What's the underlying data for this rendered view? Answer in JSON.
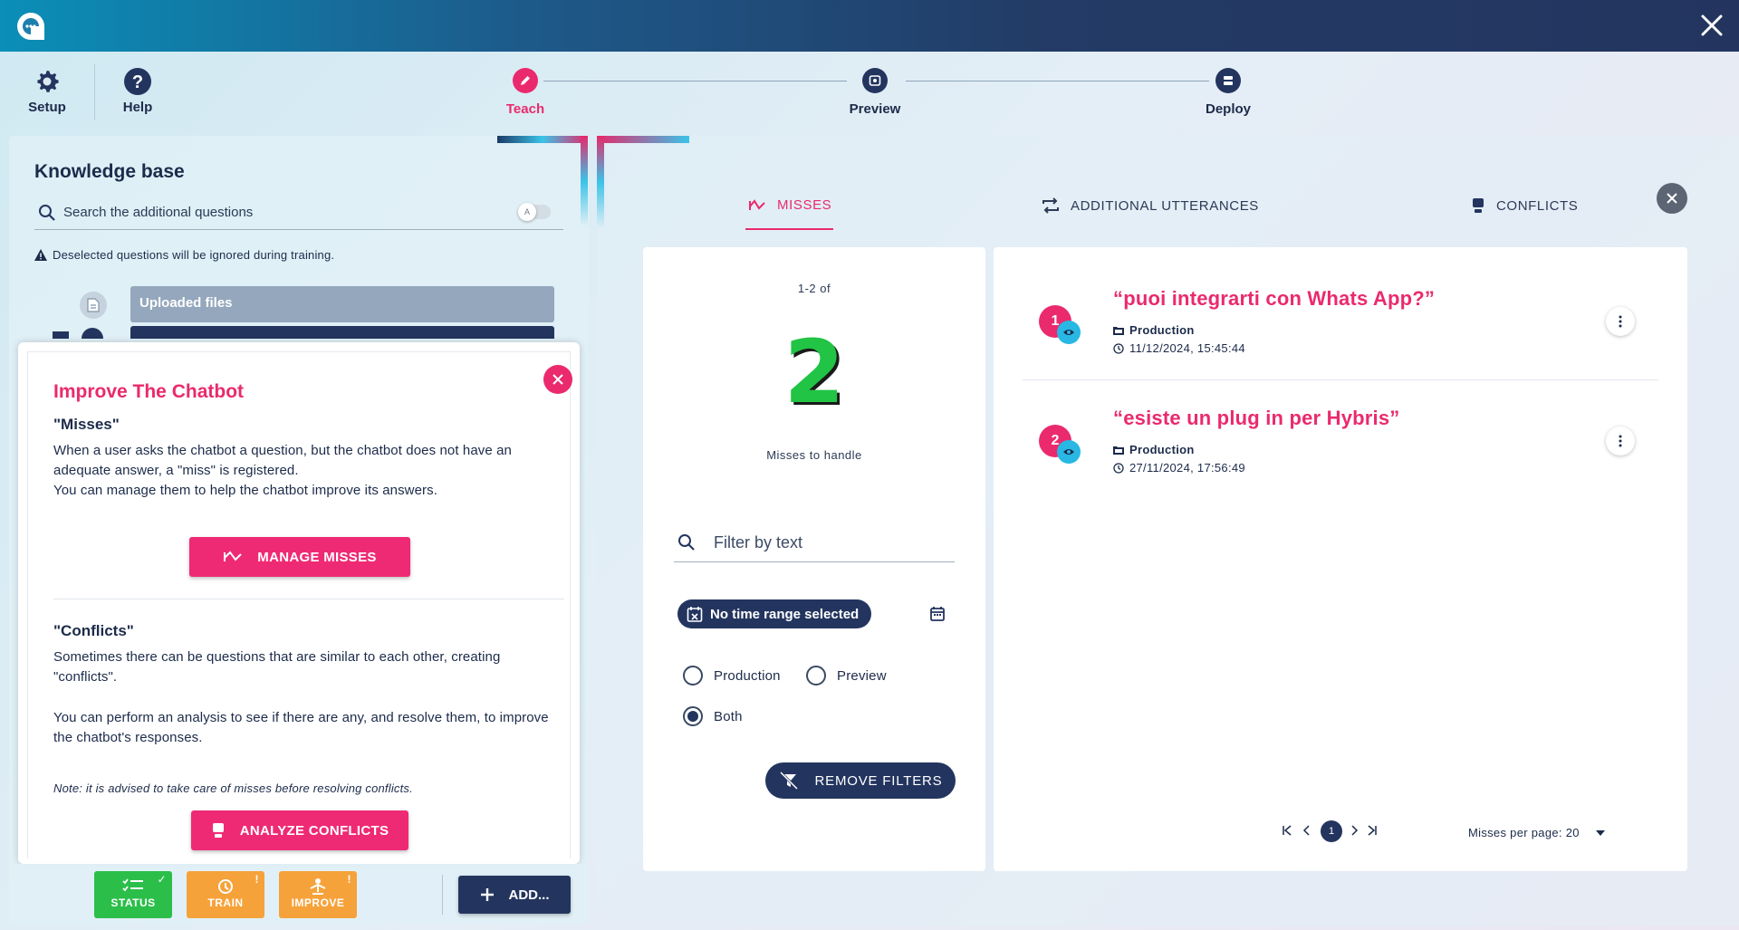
{
  "header": {
    "setup_label": "Setup",
    "help_label": "Help",
    "steps": [
      {
        "label": "Teach",
        "active": true
      },
      {
        "label": "Preview",
        "active": false
      },
      {
        "label": "Deploy",
        "active": false
      }
    ]
  },
  "colors": {
    "brand_pink": "#ea2a6d",
    "navy": "#23355f",
    "status_green": "#2bbf4a",
    "warn_orange": "#f6a23a"
  },
  "knowledge_base": {
    "title": "Knowledge base",
    "search_placeholder": "Search the additional questions",
    "warning": "Deselected questions will be ignored during training.",
    "uploaded_files": "Uploaded files"
  },
  "improve": {
    "title": "Improve The Chatbot",
    "misses_heading": "\"Misses\"",
    "misses_p1": "When a user asks the chatbot a question, but the chatbot does not have an adequate answer, a \"miss\" is registered.",
    "misses_p2": "You can manage them to help the chatbot improve its answers.",
    "manage_button": "MANAGE MISSES",
    "conflicts_heading": "\"Conflicts\"",
    "conflicts_p1": "Sometimes there can be questions that are similar to each other, creating \"conflicts\".",
    "conflicts_p2": "You can perform an analysis to see if there are any, and resolve them, to improve the chatbot's responses.",
    "note": "Note: it is advised to take care of misses before resolving conflicts.",
    "analyze_button": "ANALYZE CONFLICTS"
  },
  "toolbar": {
    "status_label": "STATUS",
    "train_label": "TRAIN",
    "improve_label": "IMPROVE",
    "add_label": "ADD..."
  },
  "tabs": {
    "misses": "MISSES",
    "utterances": "ADDITIONAL UTTERANCES",
    "conflicts": "CONFLICTS"
  },
  "filters": {
    "range_label": "1-2 of",
    "count": "2",
    "count_caption": "Misses to handle",
    "text_placeholder": "Filter by text",
    "time_chip": "No time range selected",
    "radio_production": "Production",
    "radio_preview": "Preview",
    "radio_both": "Both",
    "selected_env": "Both",
    "remove_button": "REMOVE FILTERS"
  },
  "misses": [
    {
      "index": "1",
      "question": "“puoi integrarti con Whats App?”",
      "env": "Production",
      "timestamp": "11/12/2024, 15:45:44"
    },
    {
      "index": "2",
      "question": "“esiste un plug in per Hybris”",
      "env": "Production",
      "timestamp": "27/11/2024, 17:56:49"
    }
  ],
  "pagination": {
    "current_page": "1",
    "per_page_label": "Misses per page: 20"
  }
}
